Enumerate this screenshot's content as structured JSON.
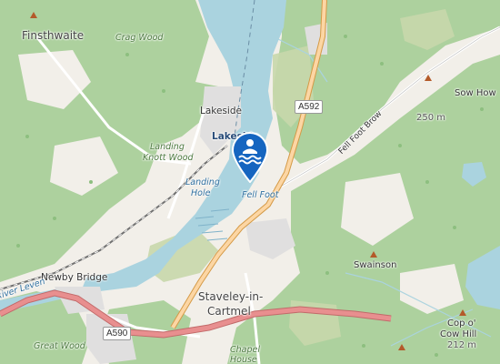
{
  "map": {
    "places": {
      "finsthwaite": "Finsthwaite",
      "lakeside": "Lakeside",
      "lakeside_station": "Lakeside",
      "newby_bridge": "Newby Bridge",
      "staveley": "Staveley-in-",
      "staveley2": "Cartmel",
      "chapel": "Chapel",
      "chapel2": "House"
    },
    "woods": {
      "crag_wood": "Crag Wood",
      "landing_knott": "Landing",
      "landing_knott2": "Knott Wood",
      "great_wood": "Great Wood"
    },
    "water": {
      "landing_hole": "Landing",
      "landing_hole2": "Hole",
      "fell_foot": "Fell Foot",
      "river_leven": "River Leven"
    },
    "roads": {
      "a592": "A592",
      "a590": "A590",
      "fell_foot_brow": "Fell Foot Brow"
    },
    "peaks": {
      "sow_how": "Sow How",
      "sow_how_ele": "250 m",
      "swainson": "Swainson",
      "cop_o": "Cop o'",
      "cow_hill": "Cow Hill",
      "cow_hill_ele": "212 m"
    },
    "marker": {
      "icon": "swimming-icon",
      "color": "#1565c0"
    },
    "colors": {
      "forest": "#add19e",
      "water": "#aad3df",
      "land": "#f2efe9",
      "primary_road": "#fcd6a4",
      "primary_road_casing": "#d49a47",
      "railway": "#707070"
    }
  }
}
